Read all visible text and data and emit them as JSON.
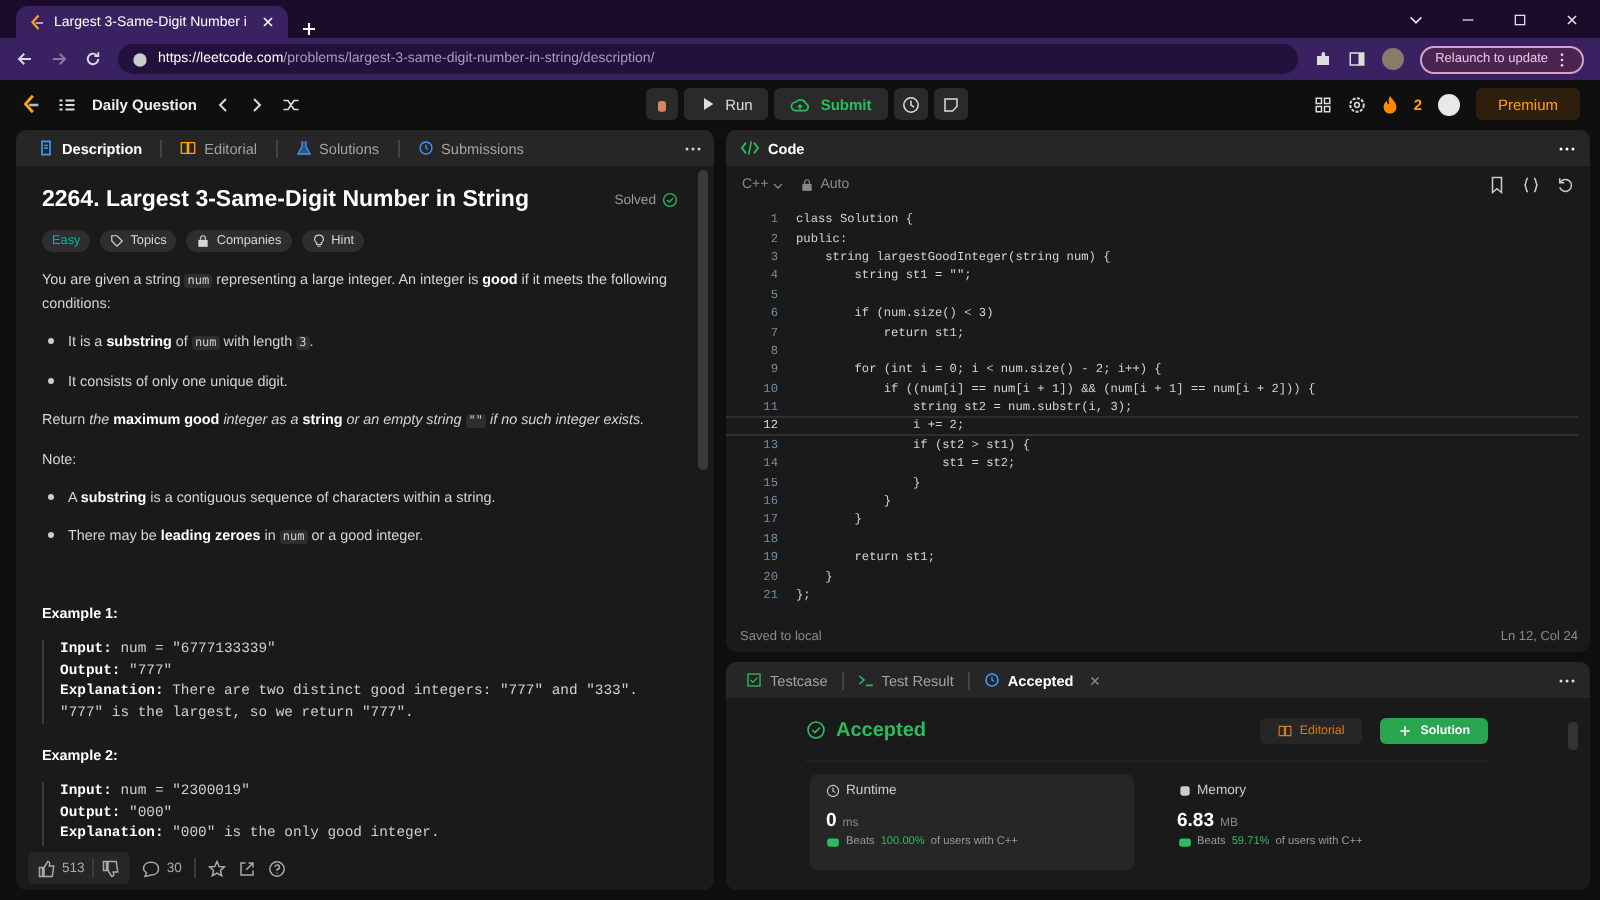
{
  "browser": {
    "tab_title": "Largest 3-Same-Digit Number i",
    "url_host": "https://leetcode.com",
    "url_path": "/problems/largest-3-same-digit-number-in-string/description/",
    "relaunch": "Relaunch to update"
  },
  "nav": {
    "daily": "Daily Question",
    "run": "Run",
    "submit": "Submit",
    "streak": "2",
    "premium": "Premium"
  },
  "description": {
    "tabs": [
      {
        "label": "Description",
        "selected": true
      },
      {
        "label": "Editorial",
        "selected": false
      },
      {
        "label": "Solutions",
        "selected": false
      },
      {
        "label": "Submissions",
        "selected": false
      }
    ],
    "title": "2264. Largest 3-Same-Digit Number in String",
    "status": "Solved",
    "difficulty": "Easy",
    "tags": [
      "Topics",
      "Companies",
      "Hint"
    ],
    "content": [
      {
        "kind": "para",
        "parts": [
          "You are given a string ",
          {
            "code": "num"
          },
          " representing a large integer. An integer is **good** if it meets the following conditions:"
        ]
      },
      {
        "kind": "bullet",
        "parts": [
          "It is a **substring** of ",
          {
            "code": "num"
          },
          " with length ",
          {
            "code": "3"
          },
          "."
        ]
      },
      {
        "kind": "bullet",
        "parts": [
          "It consists of only one unique digit."
        ]
      },
      {
        "kind": "para",
        "parts": [
          "Return *the* **maximum good** *integer as a* **string** *or an empty string* ",
          {
            "code": "\"\""
          },
          " *if no such integer exists.*"
        ]
      },
      {
        "kind": "para",
        "parts": [
          "Note:"
        ]
      },
      {
        "kind": "bullet",
        "parts": [
          "A **substring** is a contiguous sequence of characters within a string."
        ]
      },
      {
        "kind": "bullet",
        "parts": [
          "There may be **leading zeroes** in ",
          {
            "code": "num"
          },
          " or a good integer."
        ]
      }
    ],
    "examples": [
      {
        "heading": "Example 1:",
        "lines": [
          "**Input:** num = \"6777133339\"",
          "**Output:** \"777\"",
          "**Explanation:** There are two distinct good integers: \"777\" and \"333\".",
          "\"777\" is the largest, so we return \"777\"."
        ]
      },
      {
        "heading": "Example 2:",
        "lines": [
          "**Input:** num = \"2300019\"",
          "**Output:** \"000\"",
          "**Explanation:** \"000\" is the only good integer."
        ]
      }
    ],
    "likes": "513",
    "comments": "30"
  },
  "code": {
    "title": "Code",
    "language": "C++",
    "mode": "Auto",
    "lines": [
      {
        "n": "1",
        "code": "class Solution {",
        "current": false
      },
      {
        "n": "2",
        "code": "public:",
        "current": false
      },
      {
        "n": "3",
        "code": "    string largestGoodInteger(string num) {",
        "current": false
      },
      {
        "n": "4",
        "code": "        string st1 = \"\";",
        "current": false
      },
      {
        "n": "5",
        "current": false
      },
      {
        "n": "6",
        "code": "        if (num.size() < 3)",
        "current": false
      },
      {
        "n": "7",
        "code": "            return st1;",
        "current": false
      },
      {
        "n": "8",
        "current": false
      },
      {
        "n": "9",
        "code": "        for (int i = 0; i < num.size() - 2; i++) {",
        "current": false
      },
      {
        "n": "10",
        "code": "            if ((num[i] == num[i + 1]) && (num[i + 1] == num[i + 2])) {",
        "current": false
      },
      {
        "n": "11",
        "code": "                string st2 = num.substr(i, 3);",
        "current": false
      },
      {
        "n": "12",
        "code": "                i += 2;",
        "current": true
      },
      {
        "n": "13",
        "code": "                if (st2 > st1) {",
        "current": false
      },
      {
        "n": "14",
        "code": "                    st1 = st2;",
        "current": false
      },
      {
        "n": "15",
        "code": "                }",
        "current": false
      },
      {
        "n": "16",
        "code": "            }",
        "current": false
      },
      {
        "n": "17",
        "code": "        }",
        "current": false
      },
      {
        "n": "18",
        "current": false
      },
      {
        "n": "19",
        "code": "        return st1;",
        "current": false
      },
      {
        "n": "20",
        "code": "    }",
        "current": false
      },
      {
        "n": "21",
        "code": "};",
        "current": false
      }
    ],
    "saved": "Saved to local",
    "cursor": "Ln 12, Col 24"
  },
  "result": {
    "tabs": [
      {
        "label": "Testcase",
        "selected": false,
        "closable": false
      },
      {
        "label": "Test Result",
        "selected": false,
        "closable": false
      },
      {
        "label": "Accepted",
        "selected": true,
        "closable": true
      }
    ],
    "status": "Accepted",
    "editorial": "Editorial",
    "solution": "Solution",
    "metrics": [
      {
        "kind": "runtime",
        "name": "Runtime",
        "value": "0",
        "unit": "ms",
        "beats_label": "Beats",
        "beats": "100.00%",
        "suffix": "of users with C++",
        "selected": true
      },
      {
        "kind": "memory",
        "name": "Memory",
        "value": "6.83",
        "unit": "MB",
        "beats_label": "Beats",
        "beats": "59.71%",
        "suffix": "of users with C++",
        "selected": false
      }
    ]
  }
}
